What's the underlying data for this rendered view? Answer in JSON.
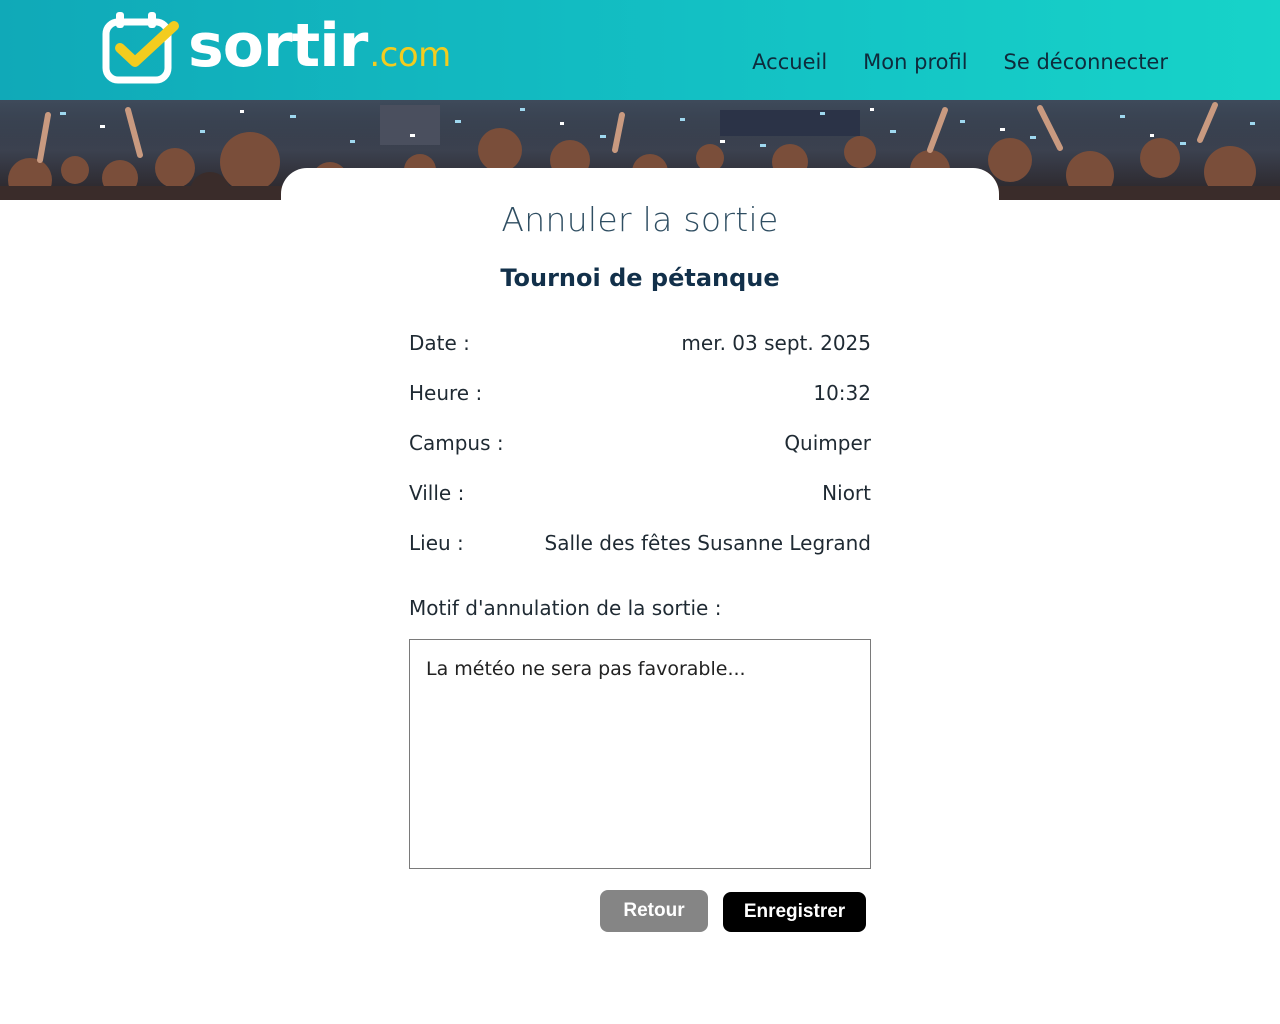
{
  "header": {
    "logo_word": "sortir",
    "logo_tld": ".com",
    "nav": [
      {
        "label": "Accueil"
      },
      {
        "label": "Mon profil"
      },
      {
        "label": "Se déconnecter"
      }
    ]
  },
  "colors": {
    "header_gradient_start": "#10a9b8",
    "header_gradient_end": "#17d3c9",
    "logo_accent": "#f3cc1f",
    "nav_text": "#0e2b3c",
    "button_retour": "#858585",
    "button_save": "#000000"
  },
  "icons": {
    "logo": "calendar-check-icon"
  },
  "page": {
    "title": "Annuler la sortie",
    "event_name": "Tournoi de pétanque"
  },
  "details": [
    {
      "label": "Date :",
      "value": "mer. 03 sept. 2025"
    },
    {
      "label": "Heure :",
      "value": "10:32"
    },
    {
      "label": "Campus :",
      "value": "Quimper"
    },
    {
      "label": "Ville :",
      "value": "Niort"
    },
    {
      "label": "Lieu :",
      "value": "Salle des fêtes Susanne Legrand"
    }
  ],
  "form": {
    "motif_label": "Motif d'annulation de la sortie :",
    "motif_value": "La météo ne sera pas favorable...",
    "retour_label": "Retour",
    "save_label": "Enregistrer"
  }
}
